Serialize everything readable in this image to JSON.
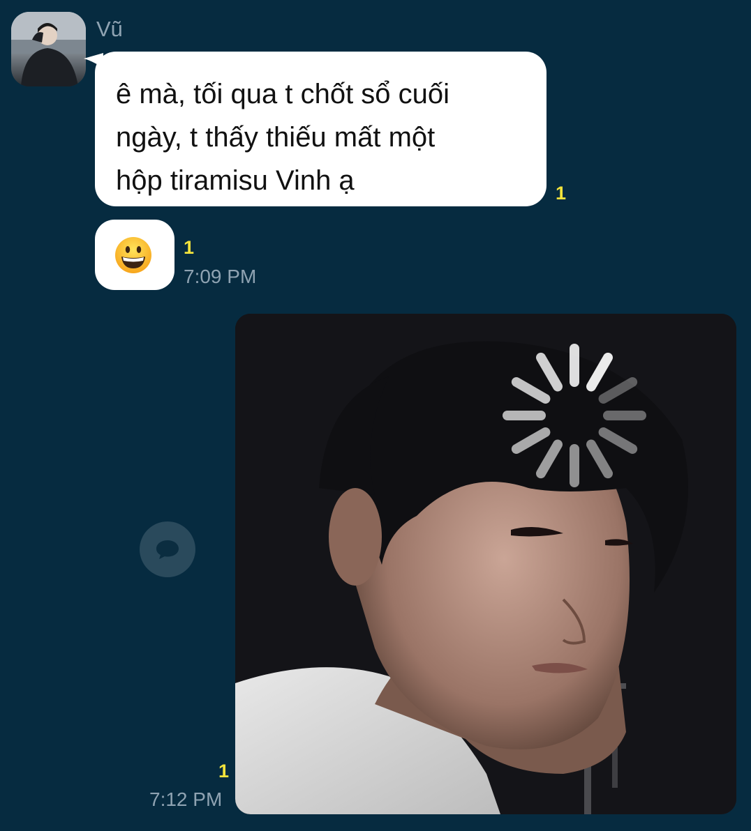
{
  "incoming": {
    "sender_name": "Vũ",
    "avatar_icon": "user-avatar",
    "message_lines": [
      "ê mà, tối qua t chốt sổ cuối",
      "ngày, t thấy thiếu mất một",
      "hộp tiramisu Vinh ạ"
    ],
    "message_unread": "1",
    "emoji_icon": "grinning-face-emoji",
    "emoji_unread": "1",
    "emoji_time": "7:09 PM"
  },
  "outgoing": {
    "photo_icon": "loading-spinner-icon",
    "unread": "1",
    "time": "7:12 PM",
    "share_icon": "share-chat-icon"
  },
  "colors": {
    "background": "#062b40",
    "bubble": "#ffffff",
    "unread": "#f2e33c",
    "meta_text": "#8fa3b2"
  }
}
